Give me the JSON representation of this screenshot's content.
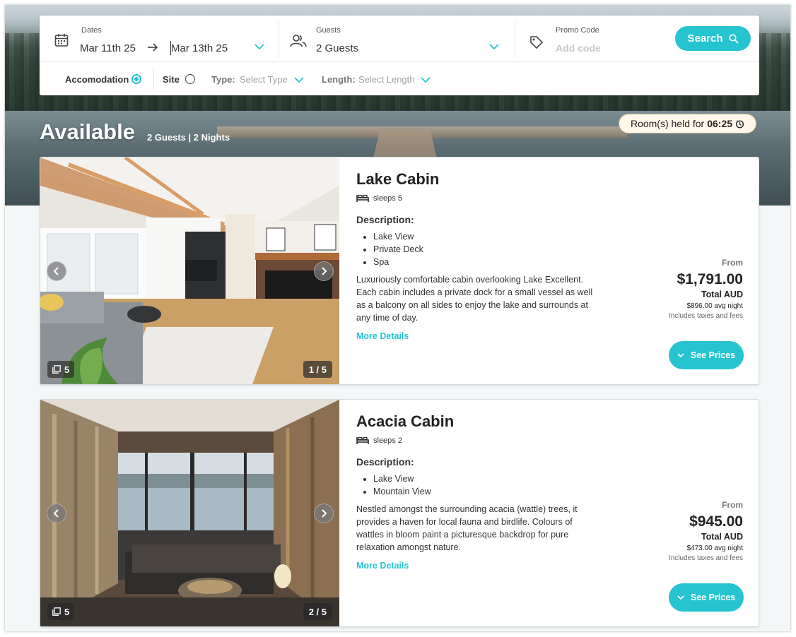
{
  "search": {
    "dates_label": "Dates",
    "check_in": "Mar 11th 25",
    "check_out": "Mar 13th 25",
    "guests_label": "Guests",
    "guests_value": "2 Guests",
    "promo_label": "Promo Code",
    "promo_placeholder": "Add code",
    "search_button": "Search"
  },
  "filters": {
    "accommodation_label": "Accomodation",
    "site_label": "Site",
    "type_label": "Type:",
    "type_placeholder": "Select Type",
    "length_label": "Length:",
    "length_placeholder": "Select Length"
  },
  "availability": {
    "title": "Available",
    "summary": "2 Guests | 2 Nights",
    "held_prefix": "Room(s) held for",
    "held_time": "06:25"
  },
  "listings": [
    {
      "name": "Lake Cabin",
      "sleeps": "sleeps 5",
      "description_heading": "Description:",
      "features": [
        "Lake View",
        "Private Deck",
        "Spa"
      ],
      "description": "Luxuriously comfortable cabin overlooking Lake Excellent. Each cabin includes a private dock for a small vessel as well as a balcony on all sides to enjoy the lake and surrounds at any time of day.",
      "more_details": "More Details",
      "price_from": "From",
      "price": "$1,791.00",
      "currency": "Total AUD",
      "avg_night": "$896.00 avg night",
      "fees_note": "Includes taxes and fees",
      "see_prices": "See Prices",
      "photo_count": "5",
      "photo_index": "1 / 5"
    },
    {
      "name": "Acacia Cabin",
      "sleeps": "sleeps 2",
      "description_heading": "Description:",
      "features": [
        "Lake View",
        "Mountain View"
      ],
      "description": "Nestled amongst the surrounding acacia (wattle) trees, it provides a haven for local fauna and birdlife. Colours of wattles in bloom paint a picturesque backdrop for pure relaxation amongst nature.",
      "more_details": "More Details",
      "price_from": "From",
      "price": "$945.00",
      "currency": "Total AUD",
      "avg_night": "$473.00 avg night",
      "fees_note": "Includes taxes and fees",
      "see_prices": "See Prices",
      "photo_count": "5",
      "photo_index": "2 / 5"
    }
  ],
  "colors": {
    "accent": "#26c4d0",
    "held_badge_bg": "#fff8ea"
  }
}
